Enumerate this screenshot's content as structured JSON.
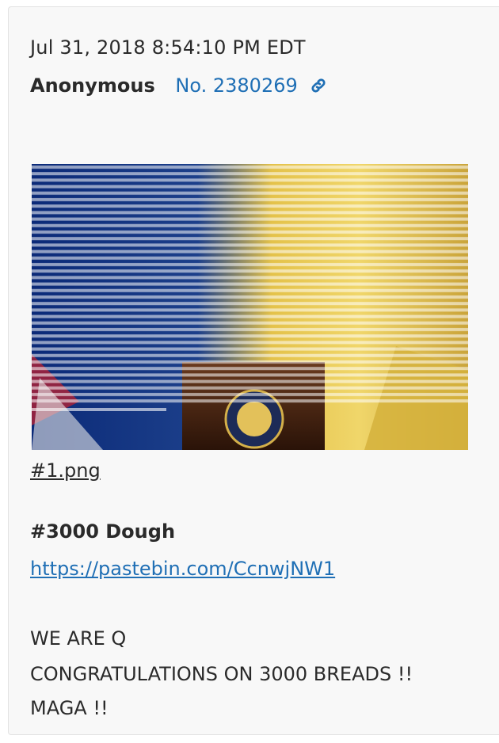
{
  "post": {
    "timestamp": "Jul 31, 2018 8:54:10 PM EDT",
    "author": "Anonymous",
    "number": "No. 2380269",
    "link_icon": "link-icon",
    "link_color": "#1f6fb5"
  },
  "attachment": {
    "filename": "#1.png"
  },
  "body": {
    "heading": "#3000 Dough",
    "link": "https://pastebin.com/CcnwjNW1",
    "lines": [
      "WE ARE Q",
      "CONGRATULATIONS ON 3000 BREADS !!",
      "MAGA !!"
    ]
  }
}
